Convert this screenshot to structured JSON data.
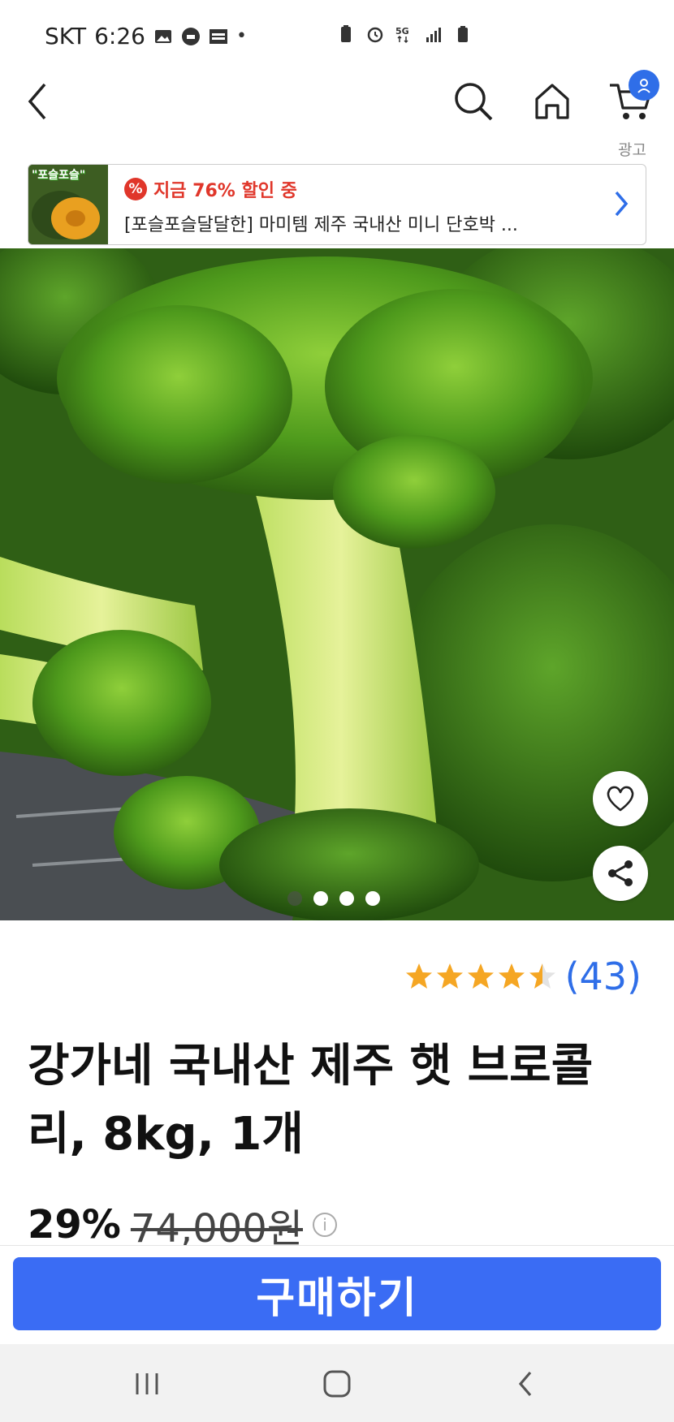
{
  "status_bar": {
    "carrier": "SKT",
    "time": "6:26",
    "network": "5G"
  },
  "nav": {
    "back_icon": "chevron-left-icon",
    "search_icon": "search-icon",
    "home_icon": "home-icon",
    "cart_icon": "cart-icon"
  },
  "ad": {
    "tag": "광고",
    "thumb_label": "\"포슬포슬\"",
    "sale_badge": "%",
    "sale_text": "지금 76% 할인 중",
    "title": "[포슬포슬달달한] 마미템 제주 국내산 미니 단호박 ..."
  },
  "product": {
    "rating": 4.5,
    "review_count": "(43)",
    "title": "강가네 국내산 제주 햇 브로콜리, 8kg, 1개",
    "discount": "29%",
    "original_price": "74,000원",
    "info_glyph": "i",
    "image_count": 4,
    "active_image": 1
  },
  "actions": {
    "buy_label": "구매하기"
  },
  "colors": {
    "accent": "#3a6cf4",
    "star": "#f5a623",
    "sale": "#e0362a"
  }
}
